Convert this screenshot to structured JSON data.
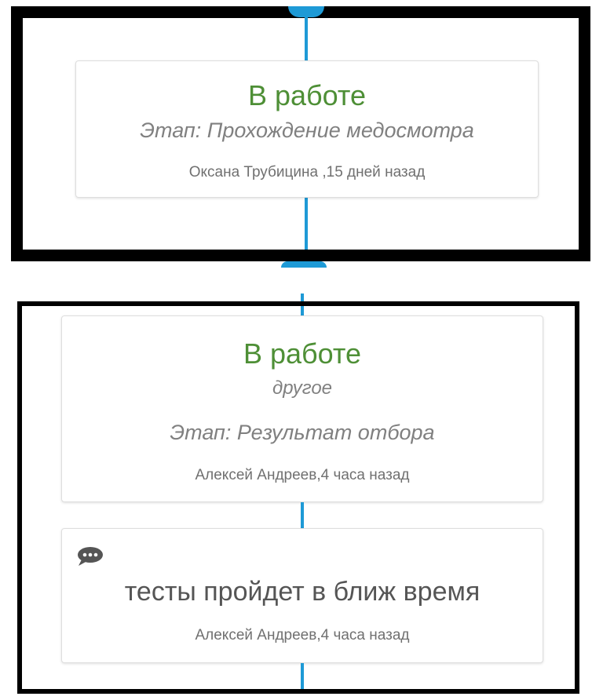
{
  "timeline": {
    "line_color": "#1e9ad6",
    "status_color": "#4e8f36"
  },
  "entry_1": {
    "status": "В работе",
    "stage": "Этап: Прохождение медосмотра",
    "meta": "Оксана Трубицина ,15 дней назад"
  },
  "entry_2": {
    "status": "В работе",
    "reason": "другое",
    "stage": "Этап: Результат отбора",
    "meta": "Алексей Андреев,4 часа назад"
  },
  "comment_1": {
    "icon": "chat-bubble-icon",
    "text": "тесты пройдет в ближ время",
    "meta": "Алексей Андреев,4 часа назад"
  }
}
